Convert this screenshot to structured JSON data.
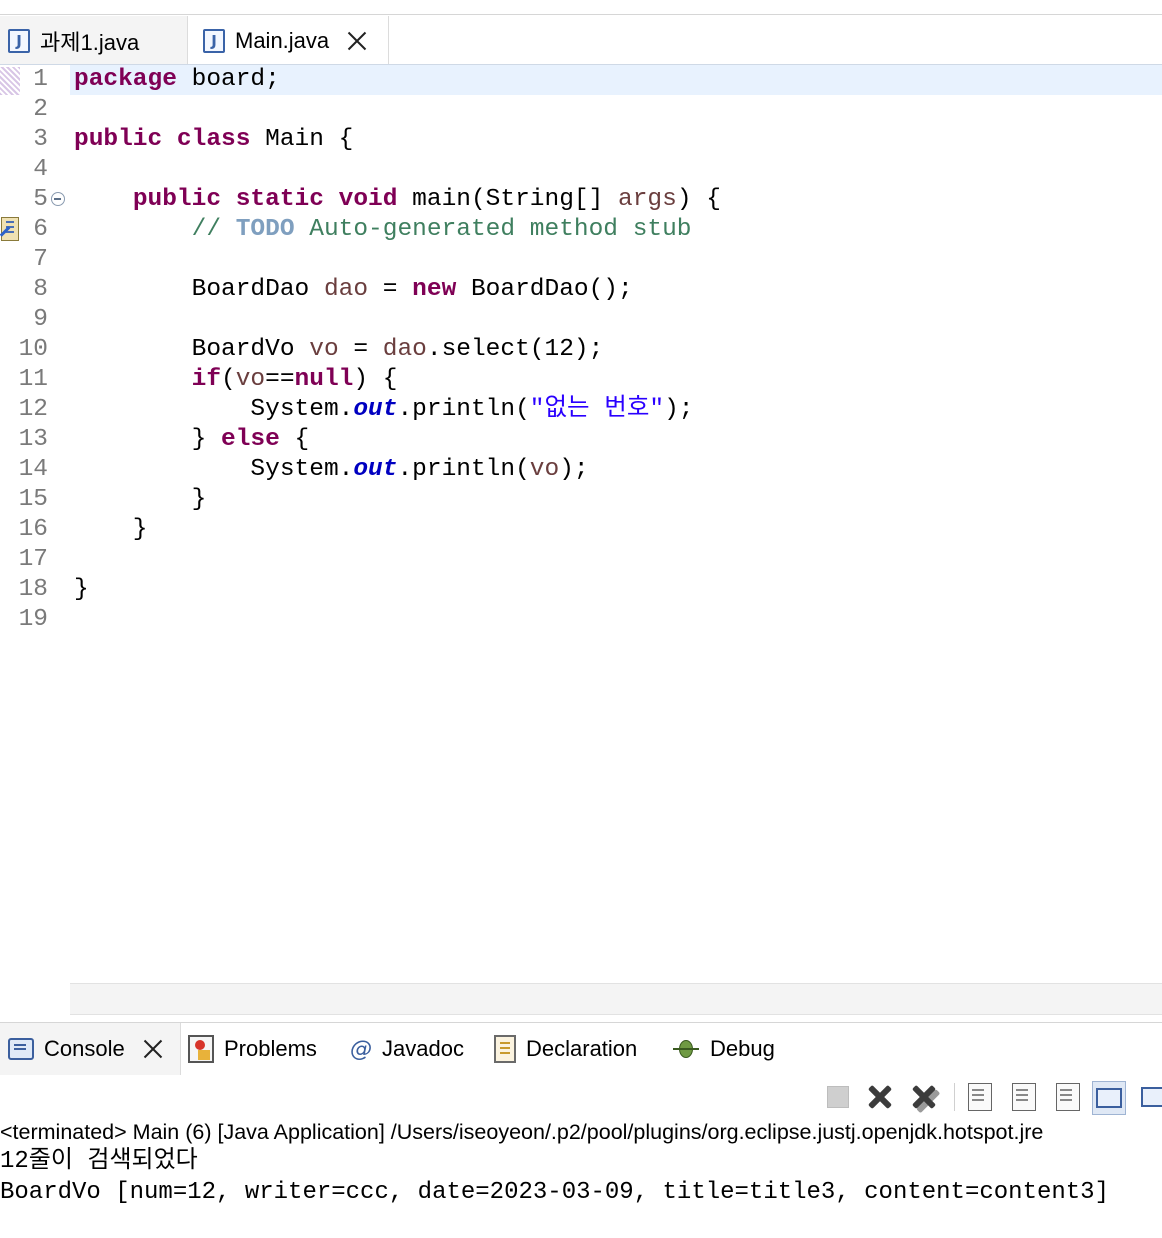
{
  "editor_tabs": [
    {
      "icon": "java-file-icon",
      "label": "과제1.java",
      "active": false
    },
    {
      "icon": "java-file-icon",
      "label": "Main.java",
      "active": true,
      "closable": true
    }
  ],
  "editor": {
    "lines": [
      {
        "num": "1",
        "tokens": [
          {
            "t": "package",
            "c": "kw"
          },
          {
            "t": " board;"
          }
        ]
      },
      {
        "num": "2",
        "tokens": []
      },
      {
        "num": "3",
        "tokens": [
          {
            "t": "public",
            "c": "kw"
          },
          {
            "t": " "
          },
          {
            "t": "class",
            "c": "kw"
          },
          {
            "t": " Main {"
          }
        ]
      },
      {
        "num": "4",
        "tokens": []
      },
      {
        "num": "5",
        "tokens": [
          {
            "t": "    "
          },
          {
            "t": "public",
            "c": "kw"
          },
          {
            "t": " "
          },
          {
            "t": "static",
            "c": "kw"
          },
          {
            "t": " "
          },
          {
            "t": "void",
            "c": "kw"
          },
          {
            "t": " main(String[] "
          },
          {
            "t": "args",
            "c": "var"
          },
          {
            "t": ") {"
          }
        ]
      },
      {
        "num": "6",
        "tokens": [
          {
            "t": "        "
          },
          {
            "t": "// ",
            "c": "cmt"
          },
          {
            "t": "TODO",
            "c": "todo"
          },
          {
            "t": " Auto-generated method stub",
            "c": "cmt"
          }
        ]
      },
      {
        "num": "7",
        "tokens": []
      },
      {
        "num": "8",
        "tokens": [
          {
            "t": "        BoardDao "
          },
          {
            "t": "dao",
            "c": "var"
          },
          {
            "t": " = "
          },
          {
            "t": "new",
            "c": "kw"
          },
          {
            "t": " BoardDao();"
          }
        ]
      },
      {
        "num": "9",
        "tokens": []
      },
      {
        "num": "10",
        "tokens": [
          {
            "t": "        BoardVo "
          },
          {
            "t": "vo",
            "c": "var"
          },
          {
            "t": " = "
          },
          {
            "t": "dao",
            "c": "var"
          },
          {
            "t": ".select(12);"
          }
        ]
      },
      {
        "num": "11",
        "tokens": [
          {
            "t": "        "
          },
          {
            "t": "if",
            "c": "kw"
          },
          {
            "t": "("
          },
          {
            "t": "vo",
            "c": "var"
          },
          {
            "t": "=="
          },
          {
            "t": "null",
            "c": "kw"
          },
          {
            "t": ") {"
          }
        ]
      },
      {
        "num": "12",
        "tokens": [
          {
            "t": "            System."
          },
          {
            "t": "out",
            "c": "field"
          },
          {
            "t": ".println("
          },
          {
            "t": "\"없는 번호\"",
            "c": "str"
          },
          {
            "t": ");"
          }
        ]
      },
      {
        "num": "13",
        "tokens": [
          {
            "t": "        } "
          },
          {
            "t": "else",
            "c": "kw"
          },
          {
            "t": " {"
          }
        ]
      },
      {
        "num": "14",
        "tokens": [
          {
            "t": "            System."
          },
          {
            "t": "out",
            "c": "field"
          },
          {
            "t": ".println("
          },
          {
            "t": "vo",
            "c": "var"
          },
          {
            "t": ");"
          }
        ]
      },
      {
        "num": "15",
        "tokens": [
          {
            "t": "        }"
          }
        ]
      },
      {
        "num": "16",
        "tokens": [
          {
            "t": "    }"
          }
        ]
      },
      {
        "num": "17",
        "tokens": []
      },
      {
        "num": "18",
        "tokens": [
          {
            "t": "}"
          }
        ]
      },
      {
        "num": "19",
        "tokens": []
      }
    ]
  },
  "panel_tabs": {
    "console": "Console",
    "problems": "Problems",
    "javadoc": "Javadoc",
    "declaration": "Declaration",
    "debug": "Debug"
  },
  "console": {
    "header": "<terminated> Main (6) [Java Application] /Users/iseoyeon/.p2/pool/plugins/org.eclipse.justj.openjdk.hotspot.jre",
    "output": [
      "12줄이 검색되었다",
      "BoardVo [num=12, writer=ccc, date=2023-03-09, title=title3, content=content3]"
    ]
  },
  "colors": {
    "keyword": "#7f0055",
    "variable": "#6a3e3e",
    "static_field": "#0000c0",
    "string": "#2a00ff",
    "comment": "#3f7f5f",
    "todo": "#7f9fbf",
    "current_line": "#e8f2fe"
  }
}
